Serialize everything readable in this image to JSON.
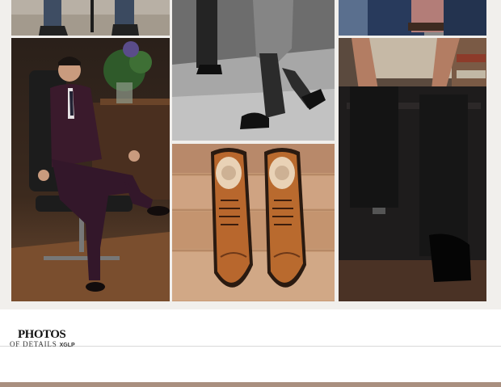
{
  "gallery": {
    "images": [
      "umbrella-legs-photo",
      "man-in-burgundy-suit-photo",
      "black-and-white-walking-legs-photo",
      "tan-wingtip-brogue-shoes-photo",
      "man-in-shirt-partial-photo",
      "man-sitting-on-trunk-photo"
    ]
  },
  "section": {
    "title": "PHOTOS",
    "subtitle": "OF DETAILS",
    "brand": "XGLP"
  }
}
